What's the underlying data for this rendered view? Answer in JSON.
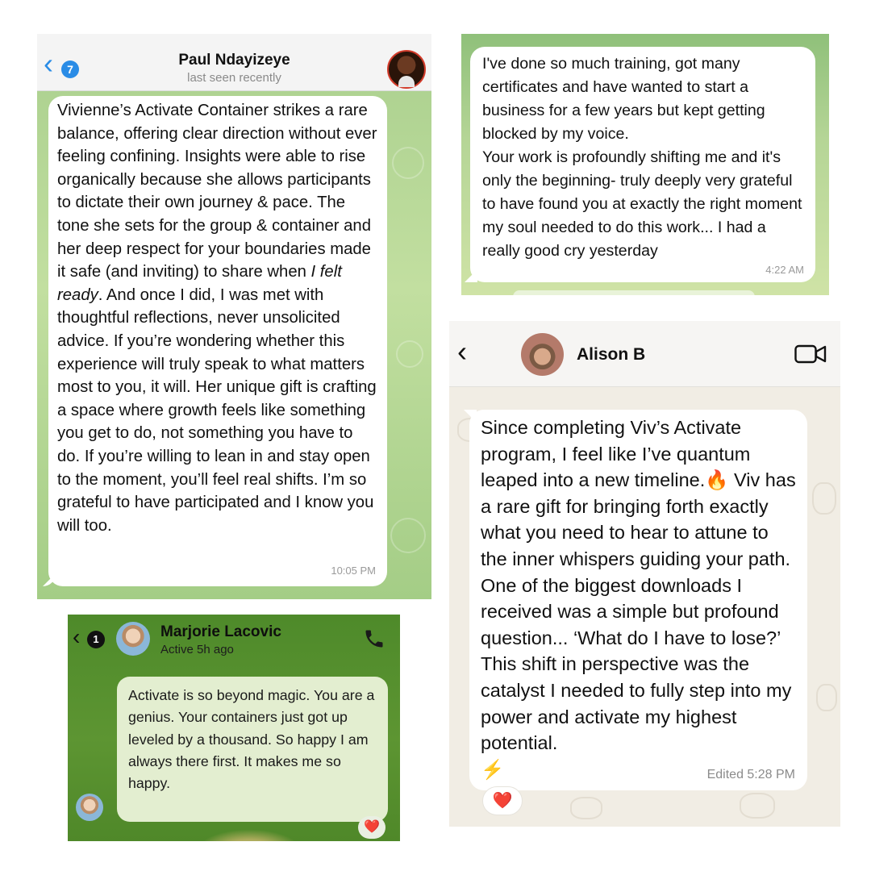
{
  "paul_chat": {
    "back_icon": "chevron-left-icon",
    "unread_count": "7",
    "contact_name": "Paul Ndayizeye",
    "status": "last seen recently",
    "message_parts": {
      "before_italic": "Vivienne’s Activate Container strikes a rare balance, offering clear direction without ever feeling confining. Insights were able to rise organically because she allows participants to dictate their own journey & pace. The tone she sets for the group & container and her deep respect for your boundaries made it safe (and inviting) to share when ",
      "italic": "I felt ready",
      "after_italic": ". And once I did, I was met with thoughtful reflections, never unsolicited advice. If you’re wondering whether this experience will truly speak to what matters most to you, it will. Her unique gift is crafting a space where growth feels like something you get to do, not something you have to do. If you’re willing to lean in and stay open to the moment, you’ll feel real shifts. I’m so grateful to have participated and I know you will too."
    },
    "time": "10:05 PM",
    "colors": {
      "accent": "#2a8ce6",
      "wallpaper": "#a9cf8d"
    }
  },
  "training_chat": {
    "message_lines": [
      "I've done so much training, got many certificates and have wanted to start a business for a few years but kept getting blocked by my voice.",
      "Your work is profoundly shifting me and it's only the beginning- truly deeply very grateful to have found you at exactly the right moment my soul needed to do this work... I had a really good cry yesterday"
    ],
    "time": "4:22 AM"
  },
  "marjorie_chat": {
    "unread_count": "1",
    "contact_name": "Marjorie Lacovic",
    "status": "Active 5h ago",
    "call_icon": "phone-icon",
    "message": "Activate is so beyond magic. You are a genius. Your containers just got up leveled by a thousand. So happy I am always there first. It makes me so happy.",
    "reaction": "❤️",
    "colors": {
      "background": "#5d9532",
      "bubble": "#e3eed0"
    }
  },
  "alison_chat": {
    "contact_name": "Alison B",
    "video_icon": "video-camera-icon",
    "message_parts": {
      "line_a": "Since completing Viv’s Activate program, I feel like I’ve quantum leaped into a new timeline.",
      "fire": "🔥",
      "line_b": " Viv has a rare gift for bringing forth exactly what you need to hear to attune  to the inner whispers guiding your path. One of the biggest downloads I received was a simple but profound question... ‘What do I have to lose?’ This shift in perspective was the catalyst I needed to fully step into my power and activate my highest potential.",
      "bolt": "⚡"
    },
    "edited_label": "Edited 5:28 PM",
    "reaction": "❤️",
    "colors": {
      "wallpaper": "#f1ede4"
    }
  }
}
